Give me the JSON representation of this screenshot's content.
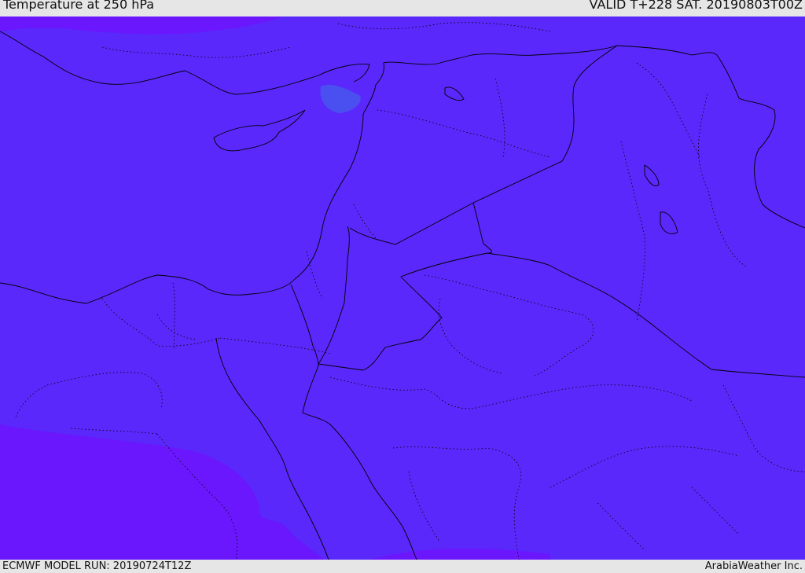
{
  "header": {
    "title": "Temperature at 250 hPa",
    "valid": "VALID T+228 SAT. 20190803T00Z"
  },
  "footer": {
    "model_run": "ECMWF MODEL RUN: 20190724T12Z",
    "credit": "ArabiaWeather Inc."
  },
  "map": {
    "colors": {
      "field_main": "#5a28fb",
      "field_cold": "#6a17fd",
      "field_warm_spot": "#4a50f0",
      "border": "#000000"
    }
  }
}
